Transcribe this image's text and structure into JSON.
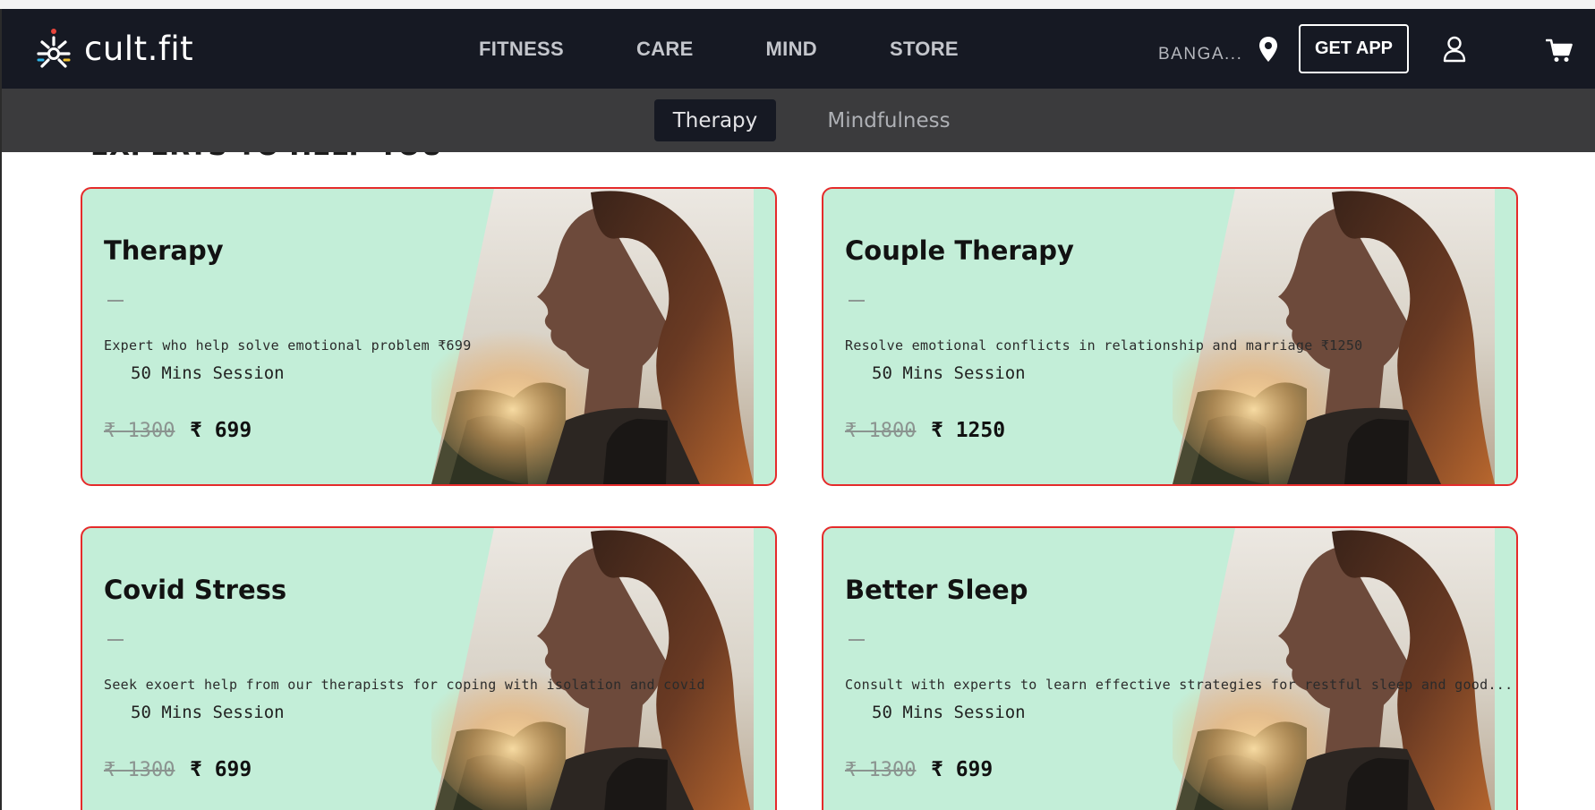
{
  "brand": {
    "name": "cult.fit"
  },
  "nav": {
    "items": [
      "FITNESS",
      "CARE",
      "MIND",
      "STORE"
    ]
  },
  "header": {
    "location": "BANGA...",
    "get_app": "GET APP"
  },
  "subnav": {
    "tabs": [
      "Therapy",
      "Mindfulness"
    ],
    "active": "Therapy"
  },
  "section": {
    "heading": "EXPERTS TO HELP YOU"
  },
  "cards": [
    {
      "title": "Therapy",
      "desc": "Expert who help solve emotional problem ₹699",
      "session": "50 Mins Session",
      "old_price": "₹ 1300",
      "new_price": "₹ 699"
    },
    {
      "title": "Couple Therapy",
      "desc": "Resolve emotional conflicts in relationship and marriage ₹1250",
      "session": "50 Mins Session",
      "old_price": "₹ 1800",
      "new_price": "₹ 1250"
    },
    {
      "title": "Covid Stress",
      "desc": "Seek exoert help from our therapists for coping with isolation and covid",
      "session": "50 Mins Session",
      "old_price": "₹ 1300",
      "new_price": "₹ 699"
    },
    {
      "title": "Better Sleep",
      "desc": "Consult with experts to learn effective strategies for restful sleep and good...",
      "session": "50 Mins Session",
      "old_price": "₹ 1300",
      "new_price": "₹ 699"
    }
  ],
  "colors": {
    "nav_bg": "#161923",
    "subnav_bg": "#3b3b3d",
    "card_bg": "#c3eed8",
    "card_border": "#e52b2b"
  },
  "icons": [
    "cult-logo-icon",
    "location-pin-icon",
    "user-icon",
    "cart-icon"
  ]
}
